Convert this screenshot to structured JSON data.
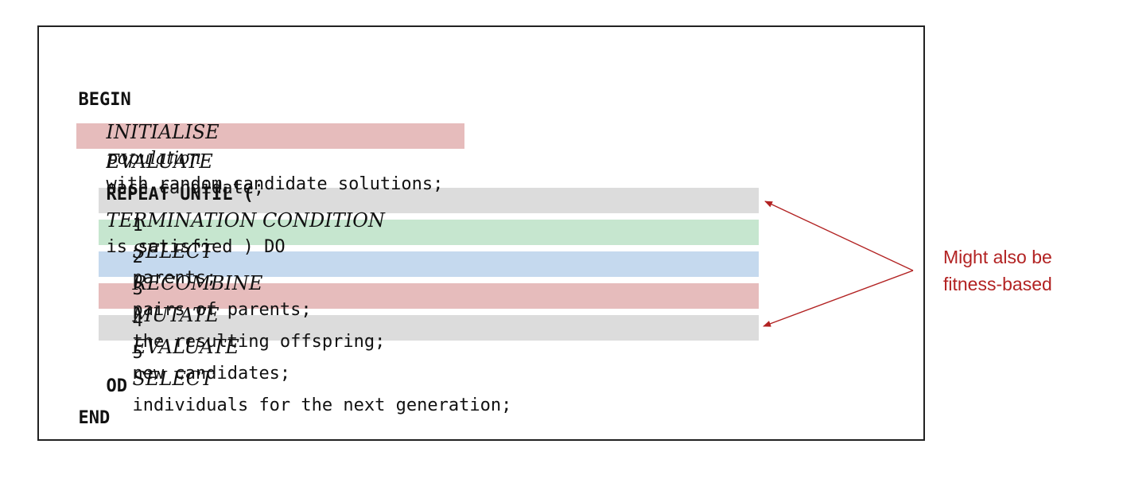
{
  "pseudocode": {
    "begin": "BEGIN",
    "initialise_kw": "INITIALISE",
    "initialise_obj": "population",
    "initialise_rest": "with random candidate solutions;",
    "evaluate_kw": "EVALUATE",
    "evaluate_rest": "each candidate;",
    "repeat_head": "REPEAT UNTIL (",
    "repeat_cond": "TERMINATION CONDITION",
    "repeat_tail": "is satisfied ) DO",
    "steps": [
      {
        "num": "1",
        "kw": "SELECT",
        "rest": "parents;",
        "color": "#dcdcdc"
      },
      {
        "num": "2",
        "kw": "RECOMBINE",
        "rest": "pairs of parents;",
        "color": "#c6e6cf"
      },
      {
        "num": "3",
        "kw": "MUTATE",
        "rest": "the resulting offspring;",
        "color": "#c5d9ee"
      },
      {
        "num": "4",
        "kw": "EVALUATE",
        "rest": "new candidates;",
        "color": "#e6bcbc"
      },
      {
        "num": "5",
        "kw": "SELECT",
        "rest": "individuals for the next generation;",
        "color": "#dcdcdc"
      }
    ],
    "od": "OD",
    "end": "END"
  },
  "annotation": {
    "line1": "Might also be",
    "line2": "fitness-based",
    "color": "#b22222"
  }
}
